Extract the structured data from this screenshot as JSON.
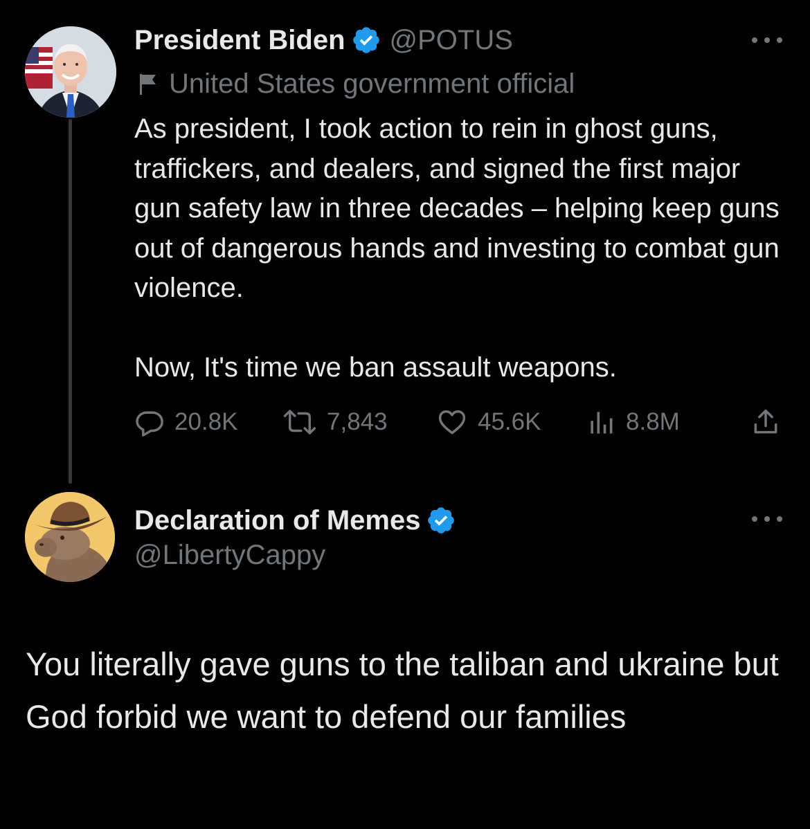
{
  "tweet": {
    "author": {
      "name": "President Biden",
      "handle": "@POTUS",
      "affiliation": "United States government official"
    },
    "text_para1": "As president, I took action to rein in ghost guns, traffickers, and dealers, and signed the first major gun safety law in three decades – helping keep guns out of dangerous hands and investing to combat gun violence.",
    "text_para2": "Now, It's time we ban assault weapons.",
    "stats": {
      "replies": "20.8K",
      "retweets": "7,843",
      "likes": "45.6K",
      "views": "8.8M"
    }
  },
  "reply": {
    "author": {
      "name": "Declaration of Memes",
      "handle": "@LibertyCappy"
    },
    "text": "You literally gave guns to the taliban and ukraine but God forbid we want to defend our families"
  },
  "colors": {
    "background": "#000000",
    "primary_text": "#e7e9ea",
    "secondary_text": "#71767b",
    "verified_badge": "#1d9bf0",
    "thread_line": "#333639"
  },
  "icons": [
    "verified-badge-icon",
    "flag-icon",
    "more-icon",
    "reply-icon",
    "retweet-icon",
    "like-icon",
    "views-icon",
    "share-icon"
  ]
}
